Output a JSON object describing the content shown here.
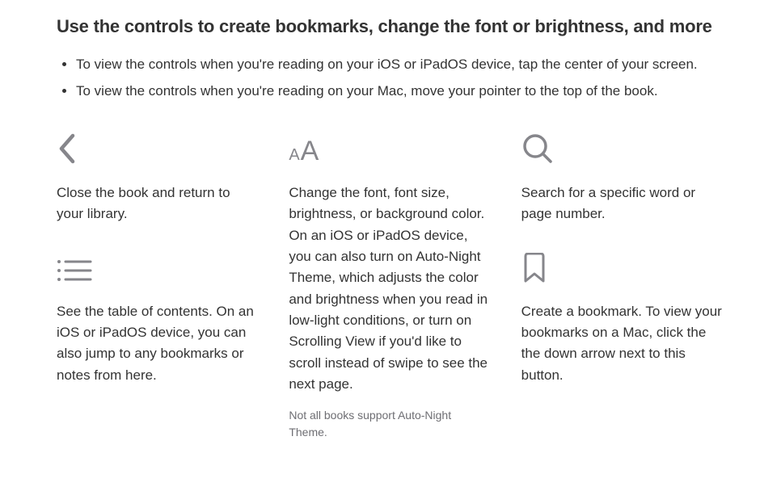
{
  "heading": "Use the controls to create bookmarks, change the font or brightness, and more",
  "bullets": [
    "To view the controls when you're reading on your iOS or iPadOS device, tap the center of your screen.",
    "To view the controls when you're reading on your Mac, move your pointer to the top of the book."
  ],
  "columns": {
    "left": [
      {
        "icon": "chevron-left-icon",
        "desc": "Close the book and return to your library."
      },
      {
        "icon": "list-icon",
        "desc": "See the table of contents. On an iOS or iPadOS device, you can also jump to any bookmarks or notes from here."
      }
    ],
    "middle": [
      {
        "icon": "font-size-icon",
        "desc": "Change the font, font size, brightness, or background color. On an iOS or iPadOS device, you can also turn on Auto-Night Theme, which adjusts the color and brightness when you read in low-light conditions, or turn on Scrolling View if you'd like to scroll instead of swipe to see the next page.",
        "note": "Not all books support Auto-Night Theme."
      }
    ],
    "right": [
      {
        "icon": "search-icon",
        "desc": "Search for a specific word or page number."
      },
      {
        "icon": "bookmark-icon",
        "desc": "Create a bookmark. To view your bookmarks on a Mac, click the the down arrow next to this button."
      }
    ]
  }
}
